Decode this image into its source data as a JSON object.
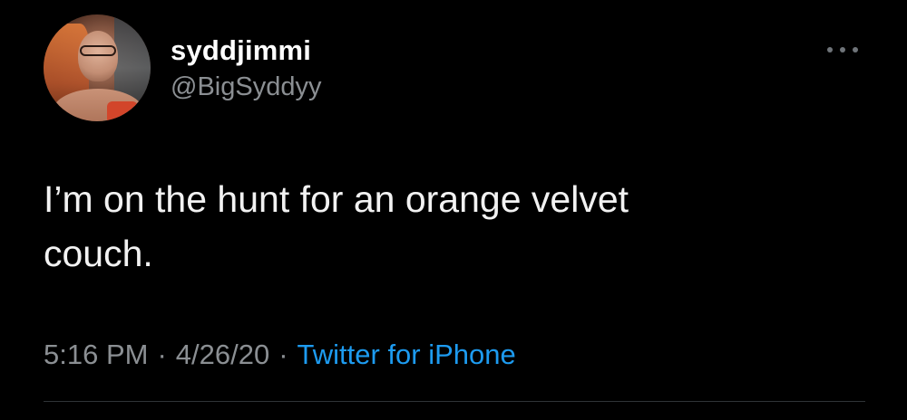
{
  "user": {
    "display_name": "syddjimmi",
    "handle": "@BigSyddyy"
  },
  "tweet": {
    "text_line1": "I’m on the hunt for an orange velvet",
    "text_line2": "couch."
  },
  "meta": {
    "time": "5:16 PM",
    "separator": "·",
    "date": "4/26/20",
    "source": "Twitter for iPhone"
  },
  "icons": {
    "more": "more-horizontal-icon",
    "avatar": "profile-avatar"
  },
  "colors": {
    "background": "#000000",
    "text": "#f2f2f2",
    "secondary": "#8b8f93",
    "link": "#1d9bf0"
  }
}
